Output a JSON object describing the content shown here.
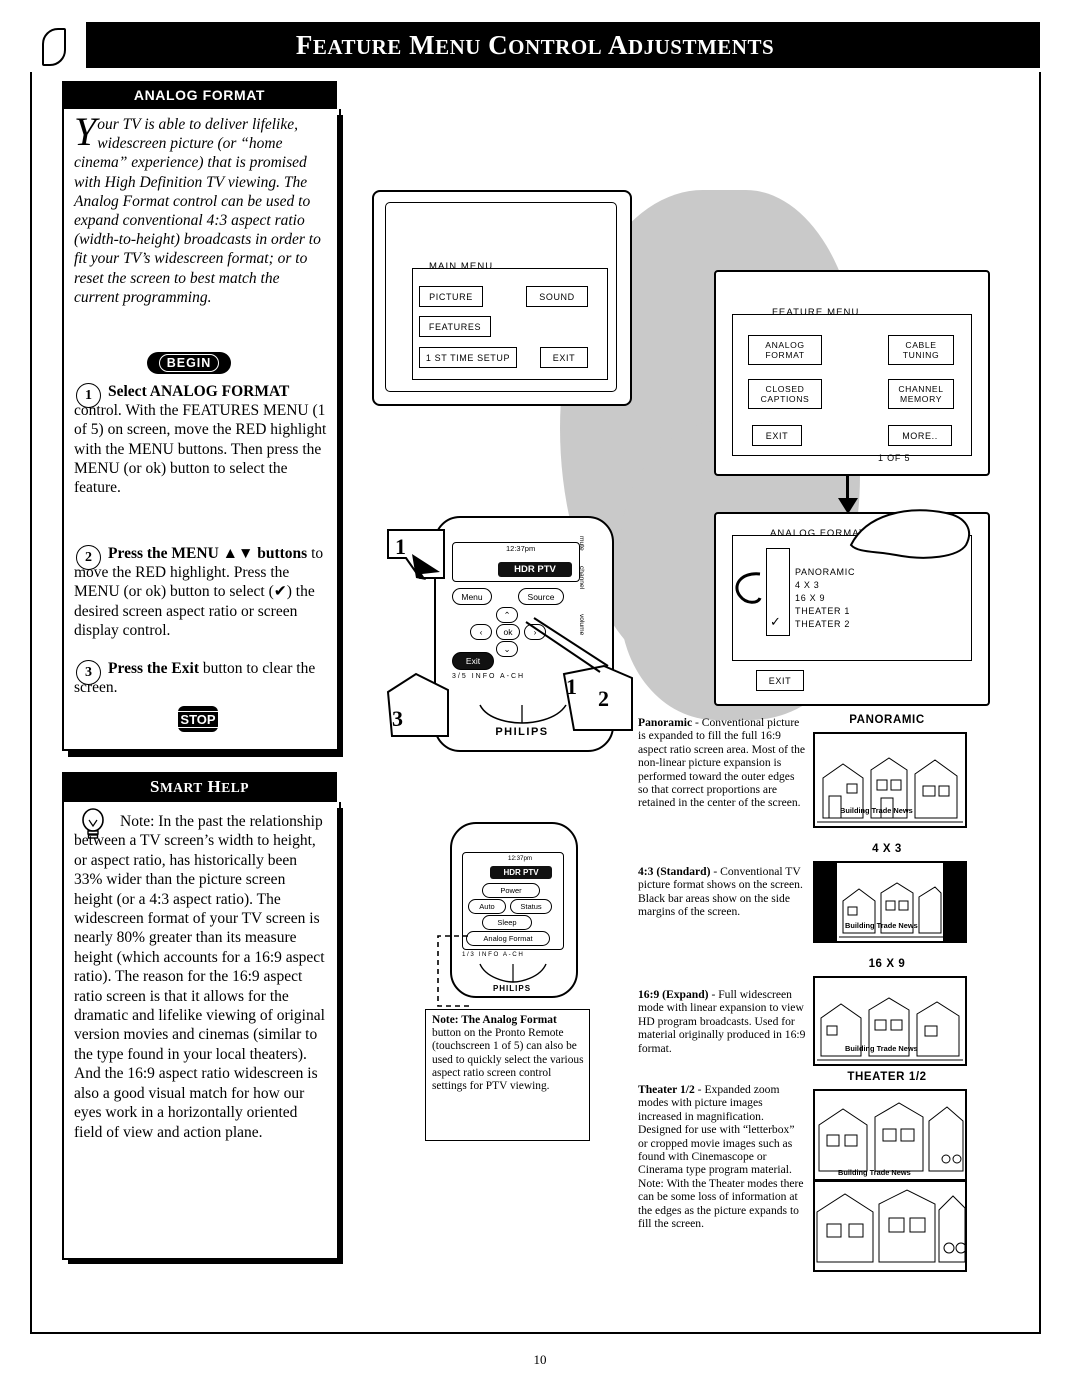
{
  "header": {
    "title_main": "FEATURE MENU CONTROL ADJUSTMENTS",
    "page_number": "10"
  },
  "analog_format": {
    "tab_label": "ANALOG FORMAT",
    "intro_dropcap": "Y",
    "intro": "our TV is able to deliver lifelike, widescreen picture (or “home cinema” experience) that is promised with High Definition TV viewing. The Analog Format control can be used to expand conventional 4:3 aspect ratio (width-to-height) broadcasts in order to fit your TV’s widescreen format; or to reset the screen to best match the current programming.",
    "begin_badge": "BEGIN",
    "stop_badge": "STOP",
    "steps": [
      {
        "num": "1",
        "bold": "Select ANALOG FORMAT",
        "rest": " control. With the FEATURES MENU (1 of 5) on screen, move the RED highlight  with the MENU  buttons. Then press the MENU (or ok) button to select the feature."
      },
      {
        "num": "2",
        "bold": "Press the MENU ▲▼ buttons",
        "rest": " to move the RED highlight. Press the MENU (or ok) button to select (✔) the desired screen aspect ratio or screen display control."
      },
      {
        "num": "3",
        "bold": "Press the Exit",
        "rest": " button to clear the screen."
      }
    ]
  },
  "smart_help": {
    "tab_label": "SMART HELP",
    "text": "Note: In the past the relationship between a TV screen’s width to height, or aspect ratio, has historically been 33% wider than the picture screen height (or a 4:3 aspect ratio). The widescreen format of your TV screen is nearly 80% greater than its measure height (which accounts for a 16:9 aspect ratio). The reason for the 16:9 aspect ratio screen is that it allows for the dramatic and lifelike viewing of original version movies and cinemas (similar to the type found in your local theaters). And the 16:9 aspect ratio widescreen is also a good visual match for how our eyes work in a horizontally oriented field of view and action plane."
  },
  "main_menu": {
    "title": "MAIN MENU",
    "buttons": [
      "PICTURE",
      "SOUND",
      "FEATURES",
      "1 ST TIME SETUP",
      "EXIT"
    ]
  },
  "feature_menu": {
    "title": "FEATURE MENU",
    "buttons": [
      "ANALOG FORMAT",
      "CABLE TUNING",
      "CLOSED CAPTIONS",
      "CHANNEL MEMORY",
      "EXIT",
      "MORE.."
    ],
    "footer": "1 OF 5"
  },
  "analog_menu": {
    "title": "ANALOG FORMAT",
    "options": [
      "PANORAMIC",
      "4 X 3",
      "16 X 9",
      "THEATER 1",
      "THEATER 2"
    ],
    "check": "✓",
    "exit": "EXIT"
  },
  "remote": {
    "brand": "PHILIPS",
    "time": "12:37pm",
    "lcd_label": "HDR PTV",
    "keys": [
      "Menu",
      "Source",
      "Exit",
      "ok"
    ],
    "side_labels": [
      "mute",
      "channel",
      "volume"
    ],
    "bottom_row": [
      "3/5",
      "INFO",
      "CH",
      "A-CH"
    ],
    "callouts": [
      "1",
      "2",
      "3",
      "1",
      "2"
    ]
  },
  "remote2": {
    "brand": "PHILIPS",
    "time": "12:37pm",
    "lcd_label": "HDR PTV",
    "keys": [
      "Power",
      "Auto",
      "Status",
      "Sleep",
      "Analog Format"
    ],
    "bottom_row": [
      "1/3",
      "INFO",
      "CH",
      "A-CH"
    ]
  },
  "note_box": {
    "title": "Note: The Analog Format",
    "text": " button on the Pronto Remote (touchscreen 1 of 5) can also be used to quickly select the various aspect ratio screen control settings for PTV viewing."
  },
  "formats": [
    {
      "title": "Panoramic",
      "dash": " - ",
      "desc": "Conventional picture is expanded to fill the full 16:9 aspect ratio screen area. Most of the non-linear picture expansion is performed toward the outer edges so that correct proportions are retained in the center of the screen.",
      "caption": "PANORAMIC",
      "pic_caption": "Building Trade News"
    },
    {
      "title": "4:3 (Standard)",
      "dash": " - ",
      "desc": "Conventional TV picture format shows on the screen. Black bar areas show on the side margins of the screen.",
      "caption": "4 X 3",
      "pic_caption": "Building Trade News"
    },
    {
      "title": "16:9 (Expand)",
      "dash": " - ",
      "desc": "Full widescreen mode with linear expansion to view HD program broadcasts. Used for material originally produced in 16:9 format.",
      "caption": "16 X 9",
      "pic_caption": "Building Trade News"
    },
    {
      "title": "Theater 1/2",
      "dash": " - ",
      "desc": "Expanded zoom modes with picture images increased in magnification. Designed for use with “letterbox” or cropped movie images such as found with Cinemascope or Cinerama type program material. Note: With the Theater modes there can be some loss of information at the edges as the picture expands to fill the screen.",
      "caption": "THEATER 1/2",
      "pic_caption": "Building Trade News"
    }
  ]
}
